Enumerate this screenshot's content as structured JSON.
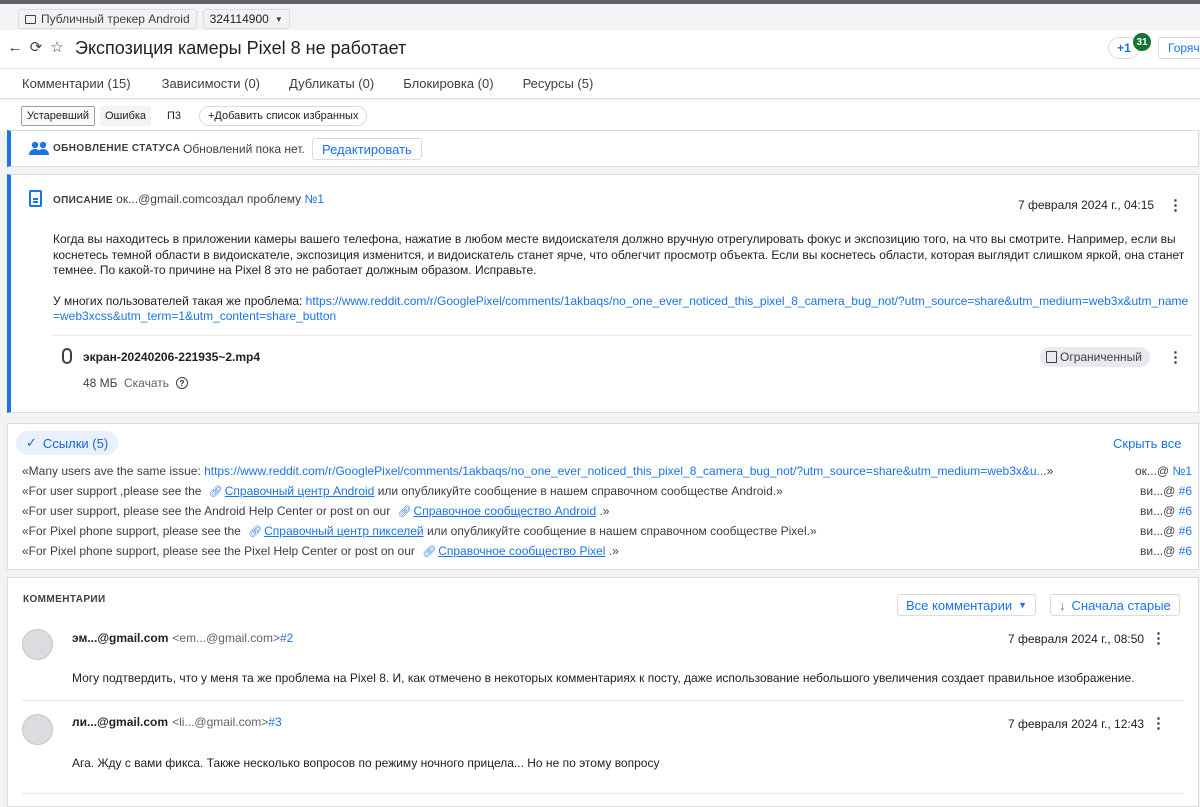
{
  "breadcrumb": {
    "tracker": "Публичный трекер Android",
    "issue_id": "324114900"
  },
  "header": {
    "title": "Экспозиция камеры Pixel 8 не работает",
    "plus_one": "+1",
    "votes": "31",
    "hot_button": "Горяч"
  },
  "tabs": [
    {
      "label": "Комментарии (15)"
    },
    {
      "label": "Зависимости (0)"
    },
    {
      "label": "Дубликаты (0)"
    },
    {
      "label": "Блокировка (0)"
    },
    {
      "label": "Ресурсы (5)"
    }
  ],
  "chips": {
    "obsolete": "Устаревший",
    "bug": "Ошибка",
    "p3": "П3",
    "add_list": "+Добавить список избранных"
  },
  "status_update": {
    "label": "ОБНОВЛЕНИЕ СТАТУСА",
    "text": "Обновлений пока нет.",
    "edit": "Редактировать"
  },
  "description": {
    "label": "ОПИСАНИЕ",
    "author": "ок...@gmail.com",
    "created": "создал проблему",
    "num": "№1",
    "date": "7 февраля 2024 г., 04:15",
    "para1": "Когда вы находитесь в приложении камеры вашего телефона, нажатие в любом месте видоискателя должно вручную отрегулировать фокус и экспозицию того, на что вы смотрите. Например, если вы коснетесь темной области в видоискателе, экспозиция изменится, и видоискатель станет ярче, что облегчит просмотр объекта. Если вы коснетесь области, которая выглядит слишком яркой, она станет темнее. По какой-то причине на Pixel 8 это не работает должным образом. Исправьте.",
    "para2_prefix": "У многих пользователей такая же проблема: ",
    "para2_link": "https://www.reddit.com/r/GooglePixel/comments/1akbaqs/no_one_ever_noticed_this_pixel_8_camera_bug_not/?utm_source=share&utm_medium=web3x&utm_name=web3xcss&utm_term=1&utm_content=share_button",
    "attachment": {
      "name": "экран-20240206-221935~2.mp4",
      "size": "48 МБ",
      "download": "Скачать",
      "restricted": "Ограниченный"
    }
  },
  "links": {
    "toggle": "Ссылки (5)",
    "hide_all": "Скрыть все",
    "rows": [
      {
        "pre": "«Many users ave the same issue: ",
        "url": "https://www.reddit.com/r/GooglePixel/comments/1akbaqs/no_one_ever_noticed_this_pixel_8_camera_bug_not/?utm_source=share&utm_medium=web3x&u...",
        "post": "»",
        "who": "ок...@",
        "num": "№1"
      },
      {
        "pre": "«For user support ,please see the ",
        "lnk": "Справочный центр Android",
        "post": " или опубликуйте сообщение в нашем справочном сообществе Android.»",
        "who": "ви...@",
        "num": "#6"
      },
      {
        "pre": "«For user support, please see the Android Help Center or post on our ",
        "lnk": "Справочное сообщество Android",
        "post": " .»",
        "who": "ви...@",
        "num": "#6"
      },
      {
        "pre": "«For Pixel phone support, please see the ",
        "lnk": "Справочный центр пикселей",
        "post": " или опубликуйте сообщение в нашем справочном сообществе Pixel.»",
        "who": "ви...@",
        "num": "#6"
      },
      {
        "pre": "«For Pixel phone support, please see the Pixel Help Center or post on our ",
        "lnk": "Справочное сообщество Pixel",
        "post": " .»",
        "who": "ви...@",
        "num": "#6"
      }
    ]
  },
  "comments": {
    "title": "КОММЕНТАРИИ",
    "filter": "Все комментарии",
    "sort": "Сначала старые",
    "items": [
      {
        "author": "эм...@gmail.com",
        "email": "<em...@gmail.com>",
        "num": "#2",
        "date": "7 февраля 2024 г., 08:50",
        "text": "Могу подтвердить, что у меня та же проблема на Pixel 8. И, как отмечено в некоторых комментариях к посту, даже использование небольшого увеличения создает правильное изображение."
      },
      {
        "author": "ли...@gmail.com",
        "email": "<li...@gmail.com>",
        "num": "#3",
        "date": "7 февраля 2024 г., 12:43",
        "text": "Ага. Жду с вами фикса. Также несколько вопросов по режиму ночного прицела... Но не по этому вопросу"
      }
    ]
  }
}
